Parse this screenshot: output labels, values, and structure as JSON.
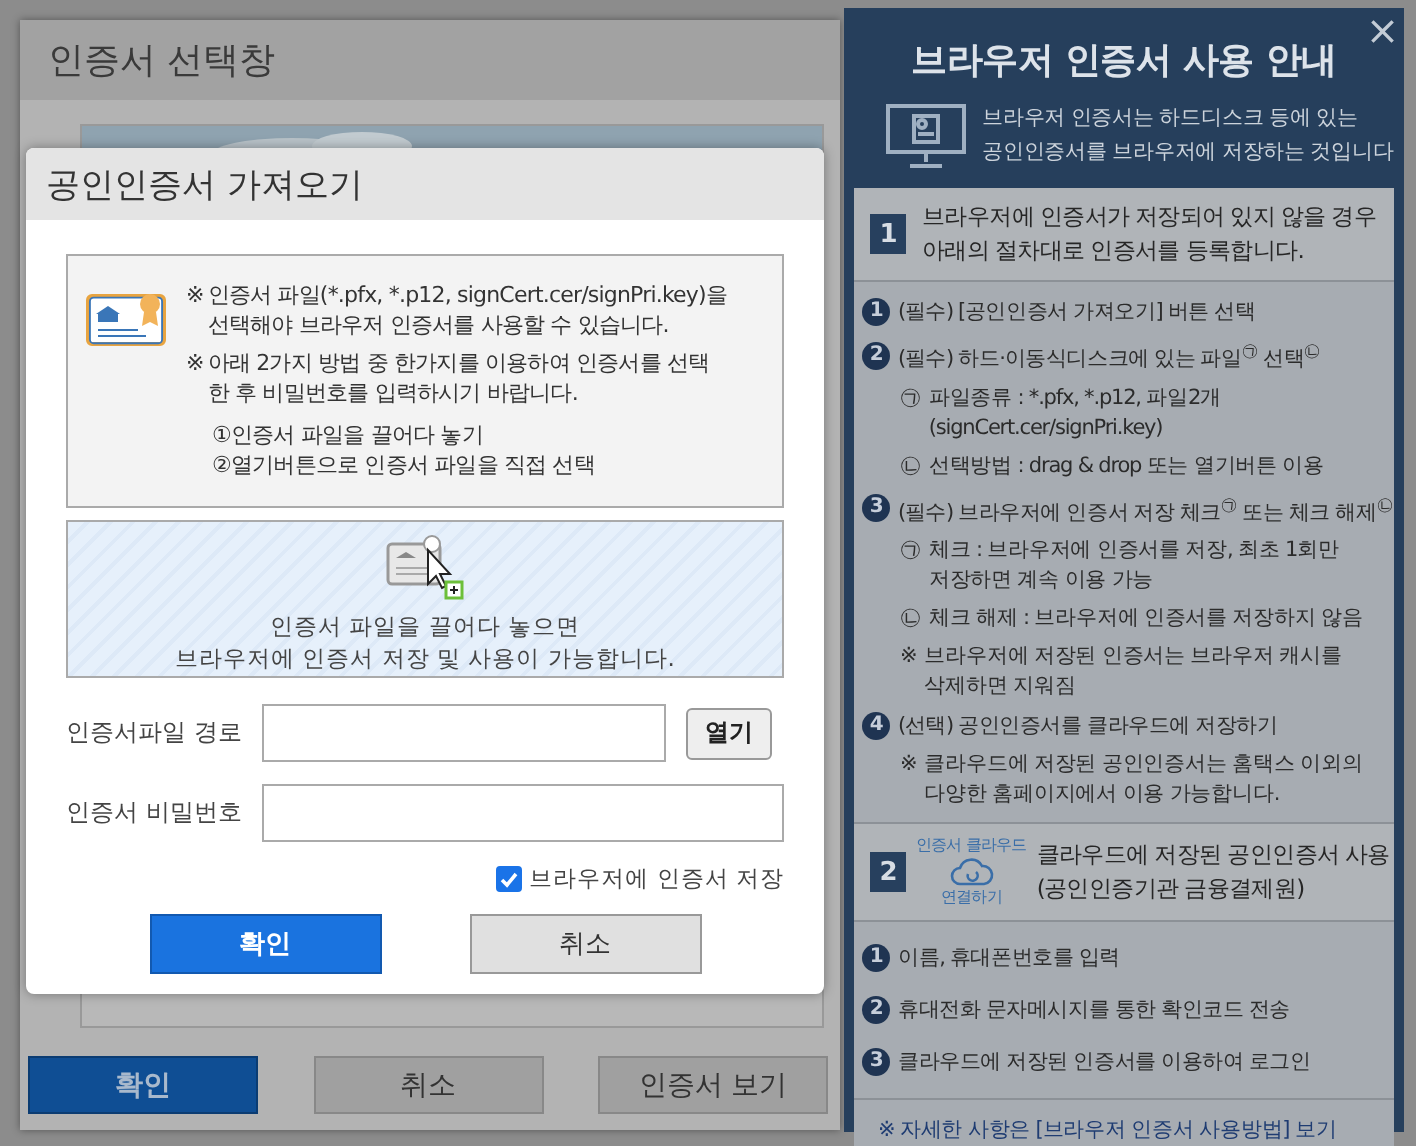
{
  "background_window": {
    "title": "인증서 선택창",
    "buttons": [
      {
        "label": "확인",
        "kind": "primary"
      },
      {
        "label": "취소",
        "kind": "secondary"
      },
      {
        "label": "인증서 보기",
        "kind": "secondary"
      }
    ]
  },
  "guide_panel": {
    "title": "브라우저 인증서 사용 안내",
    "close": "×",
    "intro": [
      "브라우저 인증서는 하드디스크 등에 있는",
      "공인인증서를 브라우저에 저장하는 것입니다"
    ],
    "sections": [
      {
        "number": "1",
        "heading": [
          "브라우저에 인증서가 저장되어 있지 않을 경우",
          "아래의 절차대로 인증서를 등록합니다."
        ],
        "steps": [
          {
            "number": "1",
            "text": "(필수) [공인인증서 가져오기] 버튼 선택"
          },
          {
            "number": "2",
            "text": "(필수) 하드·이동식디스크에 있는 파일$^{㉠}$ 선택$^{㉡}$",
            "notes": [
              {
                "marker": "㉠",
                "lines": [
                  "파일종류 : *.pfx, *.p12, 파일2개",
                  "(signCert.cer/signPri.key)"
                ]
              },
              {
                "marker": "㉡",
                "lines": [
                  "선택방법 : drag & drop 또는 열기버튼 이용"
                ]
              }
            ]
          },
          {
            "number": "3",
            "text": "(필수) 브라우저에 인증서 저장 체크$^{㉠}$ 또는 체크 해제$^{㉡}$",
            "notes": [
              {
                "marker": "㉠",
                "lines": [
                  "체크 :  브라우저에 인증서를 저장, 최초 1회만",
                  "저장하면 계속 이용 가능"
                ]
              },
              {
                "marker": "㉡",
                "lines": [
                  "체크 해제 : 브라우저에 인증서를 저장하지 않음"
                ]
              },
              {
                "marker": "※",
                "lines": [
                  "브라우저에 저장된 인증서는 브라우저 캐시를",
                  "삭제하면 지워짐"
                ]
              }
            ]
          },
          {
            "number": "4",
            "text": "(선택) 공인인증서를 클라우드에 저장하기",
            "notes": [
              {
                "marker": "※",
                "lines": [
                  "클라우드에 저장된 공인인증서는 홈택스 이외의",
                  "다양한 홈페이지에서 이용 가능합니다."
                ]
              }
            ]
          }
        ]
      },
      {
        "number": "2",
        "badge": {
          "top": "인증서 클라우드",
          "bottom": "연결하기"
        },
        "heading": [
          "클라우드에 저장된 공인인증서 사용",
          "(공인인증기관 금융결제원)"
        ],
        "steps": [
          {
            "number": "1",
            "text": "이름, 휴대폰번호를 입력"
          },
          {
            "number": "2",
            "text": "휴대전화 문자메시지를 통한 확인코드 전송"
          },
          {
            "number": "3",
            "text": "클라우드에 저장된 인증서를 이용하여 로그인"
          }
        ]
      }
    ],
    "footer_link": "※ 자세한 사항은 [브라우저 인증서 사용방법] 보기"
  },
  "import_dialog": {
    "title": "공인인증서 가져오기",
    "info": {
      "notes": [
        {
          "marker": "※",
          "lines": [
            "인증서 파일(*.pfx, *.p12, signCert.cer/signPri.key)을",
            "선택해야 브라우저 인증서를 사용할 수 있습니다."
          ]
        },
        {
          "marker": "※",
          "lines": [
            "아래 2가지 방법 중 한가지를 이용하여 인증서를 선택",
            "한 후 비밀번호를 입력하시기 바랍니다."
          ]
        }
      ],
      "choices": [
        "①인증서 파일을 끌어다 놓기",
        "②열기버튼으로 인증서 파일을 직접 선택"
      ]
    },
    "drop_zone": [
      "인증서 파일을 끌어다 놓으면",
      "브라우저에 인증서 저장 및 사용이 가능합니다."
    ],
    "fields": [
      {
        "label": "인증서파일 경로",
        "kind": "file",
        "button": "열기"
      },
      {
        "label": "인증서 비밀번호",
        "kind": "password"
      }
    ],
    "save_option": {
      "label": "브라우저에 인증서 저장",
      "checked": true
    },
    "buttons": [
      {
        "label": "확인",
        "kind": "primary"
      },
      {
        "label": "취소",
        "kind": "secondary"
      }
    ]
  }
}
